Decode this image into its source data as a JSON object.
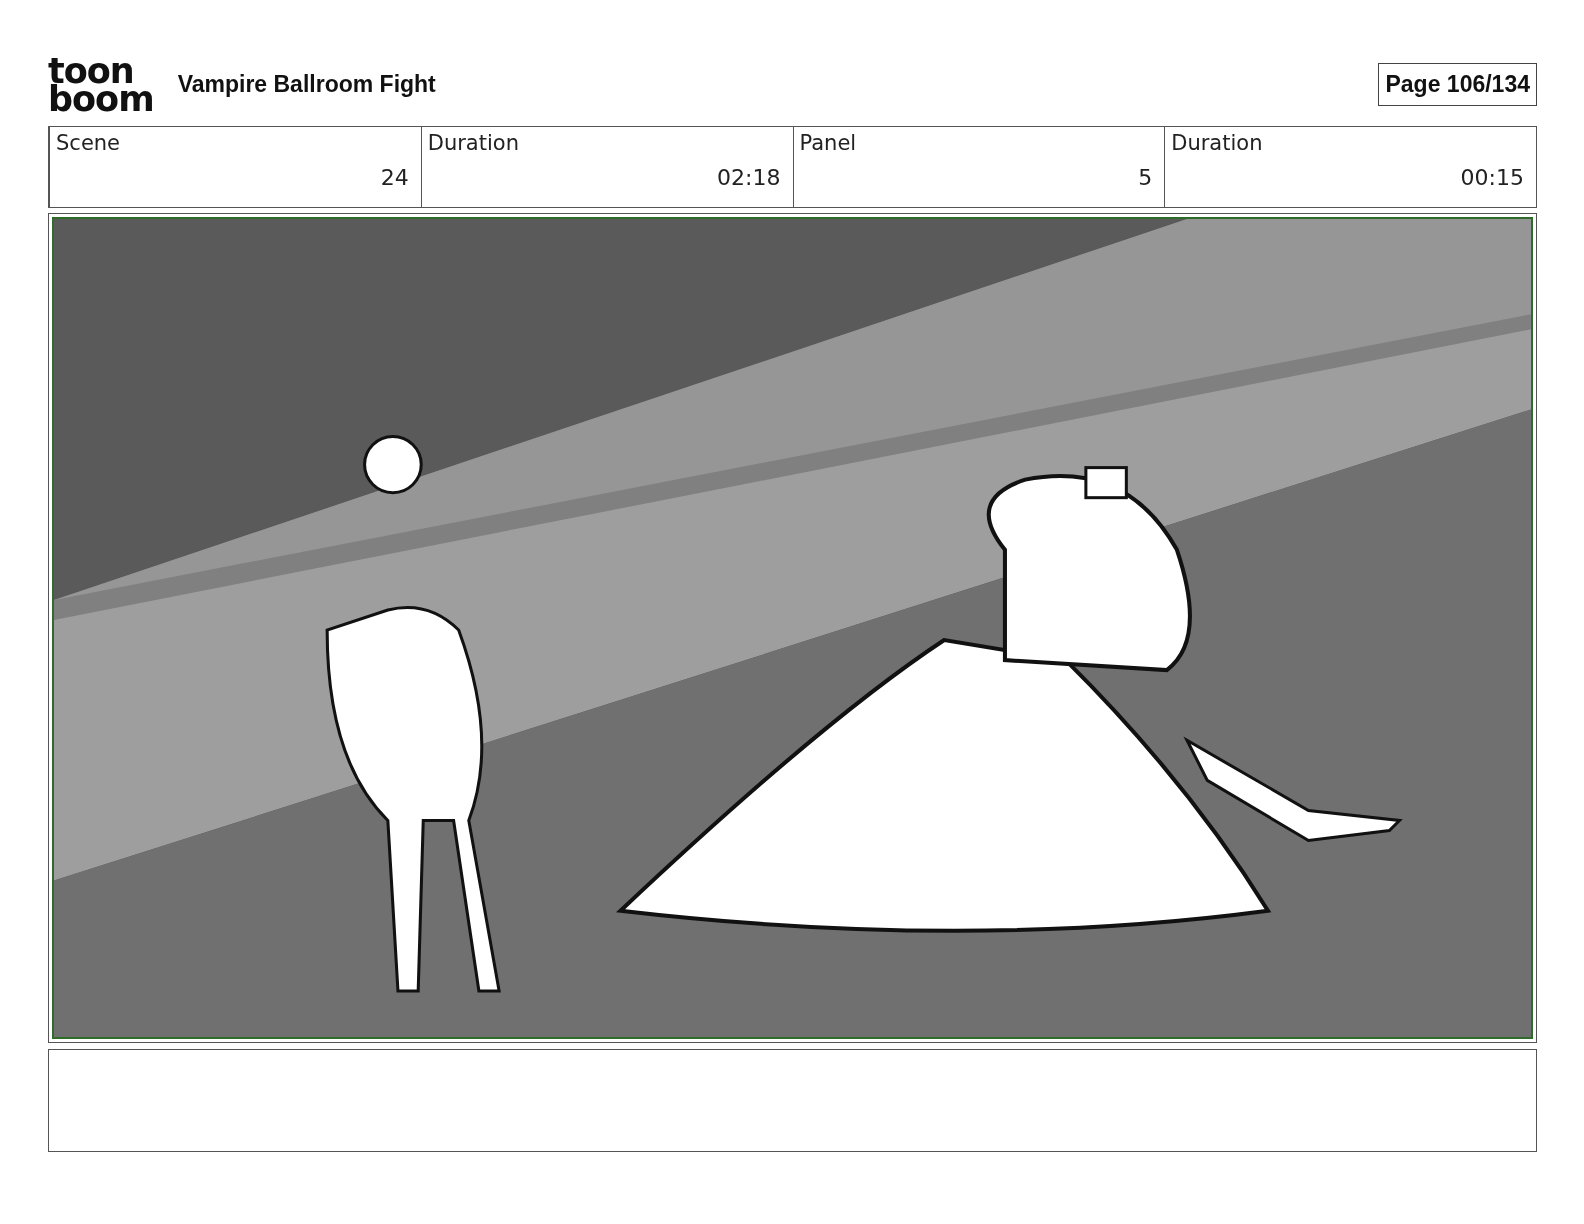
{
  "header": {
    "logo": [
      "toon",
      "boom"
    ],
    "title": "Vampire Ballroom Fight",
    "page": "Page 106/134"
  },
  "info": [
    {
      "label": "Scene",
      "value": "24"
    },
    {
      "label": "Duration",
      "value": "02:18"
    },
    {
      "label": "Panel",
      "value": "5"
    },
    {
      "label": "Duration",
      "value": "00:15"
    }
  ]
}
